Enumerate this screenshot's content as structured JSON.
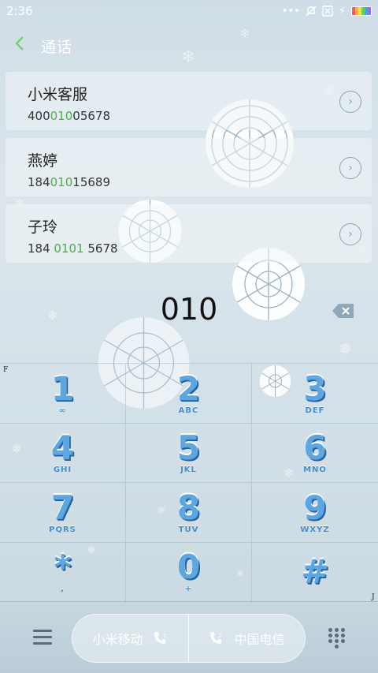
{
  "status": {
    "time": "2:36",
    "icons": [
      "dots-icon",
      "mute-icon",
      "sim-off-icon",
      "charging-icon",
      "battery-icon"
    ]
  },
  "header": {
    "title": "通话"
  },
  "contacts": [
    {
      "name": "小米客服",
      "num_pre": "400",
      "num_hl": "010",
      "num_post": "05678"
    },
    {
      "name": "燕婷",
      "num_pre": "184",
      "num_hl": "010",
      "num_post": "15689"
    },
    {
      "name": "子玲",
      "num_pre": "184 ",
      "num_hl": "0101",
      "num_post": " 5678"
    }
  ],
  "dial": {
    "input": "010"
  },
  "keypad": [
    {
      "digit": "1",
      "letters": "∞"
    },
    {
      "digit": "2",
      "letters": "ABC"
    },
    {
      "digit": "3",
      "letters": "DEF"
    },
    {
      "digit": "4",
      "letters": "GHI"
    },
    {
      "digit": "5",
      "letters": "JKL"
    },
    {
      "digit": "6",
      "letters": "MNO"
    },
    {
      "digit": "7",
      "letters": "PQRS"
    },
    {
      "digit": "8",
      "letters": "TUV"
    },
    {
      "digit": "9",
      "letters": "WXYZ"
    },
    {
      "digit": "*",
      "letters": ","
    },
    {
      "digit": "0",
      "letters": "+"
    },
    {
      "digit": "#",
      "letters": ""
    }
  ],
  "corners": {
    "f": "F",
    "j": "J"
  },
  "bottom": {
    "sim1": "小米移动",
    "sim2": "中国电信"
  },
  "colors": {
    "accent_green": "#4cae4c",
    "key_blue": "#5ea6e0"
  }
}
